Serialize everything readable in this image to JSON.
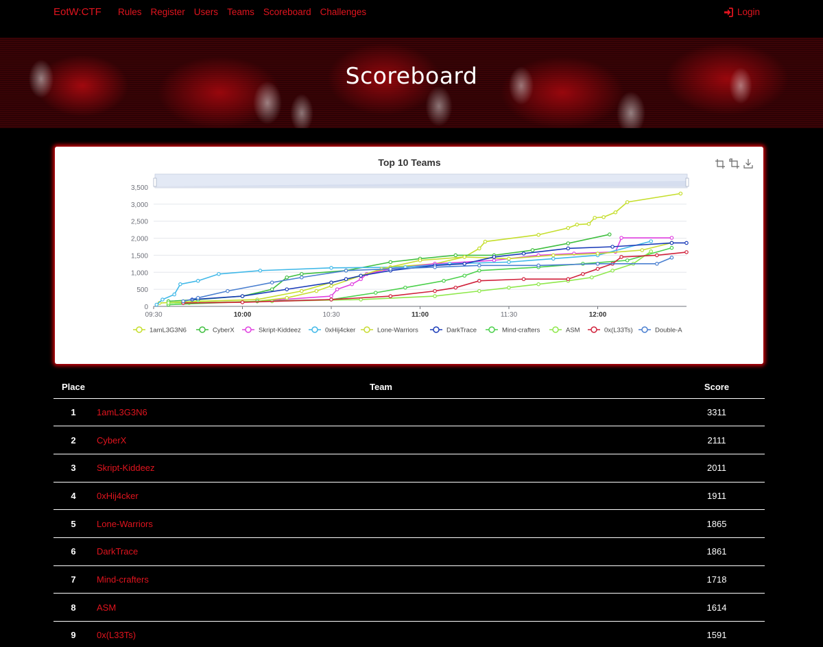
{
  "navbar": {
    "brand": "EotW:CTF",
    "links": [
      "Rules",
      "Register",
      "Users",
      "Teams",
      "Scoreboard",
      "Challenges"
    ],
    "login_label": "Login"
  },
  "hero": {
    "title": "Scoreboard"
  },
  "table": {
    "headers": {
      "place": "Place",
      "team": "Team",
      "score": "Score"
    },
    "rows": [
      {
        "place": "1",
        "team": "1amL3G3N6",
        "score": "3311"
      },
      {
        "place": "2",
        "team": "CyberX",
        "score": "2111"
      },
      {
        "place": "3",
        "team": "Skript-Kiddeez",
        "score": "2011"
      },
      {
        "place": "4",
        "team": "0xHij4cker",
        "score": "1911"
      },
      {
        "place": "5",
        "team": "Lone-Warriors",
        "score": "1865"
      },
      {
        "place": "6",
        "team": "DarkTrace",
        "score": "1861"
      },
      {
        "place": "7",
        "team": "Mind-crafters",
        "score": "1718"
      },
      {
        "place": "8",
        "team": "ASM",
        "score": "1614"
      },
      {
        "place": "9",
        "team": "0x(L33Ts)",
        "score": "1591"
      }
    ]
  },
  "colors": {
    "accent": "#e0141e",
    "background": "#000000",
    "card_glow": "#c8000a"
  },
  "icons": {
    "login": "sign-in-icon",
    "toolbox": [
      "zoom-icon",
      "zoom-reset-icon",
      "save-image-icon"
    ]
  },
  "chart_data": {
    "type": "line",
    "title": "Top 10 Teams",
    "x_ticks": [
      "09:30",
      "10:00",
      "10:30",
      "11:00",
      "11:30",
      "12:00"
    ],
    "x_bold_ticks": [
      "10:00",
      "11:00",
      "12:00"
    ],
    "xlim": [
      "09:30",
      "12:30"
    ],
    "y_ticks": [
      "0",
      "500",
      "1,000",
      "1,500",
      "2,000",
      "2,500",
      "3,000",
      "3,500"
    ],
    "ylim": [
      0,
      3500
    ],
    "grid": true,
    "legend_position": "bottom",
    "data_zoom_slider": true,
    "series": [
      {
        "name": "1amL3G3N6",
        "color": "#c5de2b",
        "points": [
          [
            "09:32",
            100
          ],
          [
            "09:45",
            150
          ],
          [
            "10:05",
            200
          ],
          [
            "10:20",
            450
          ],
          [
            "10:30",
            700
          ],
          [
            "10:40",
            900
          ],
          [
            "10:50",
            1150
          ],
          [
            "11:05",
            1250
          ],
          [
            "11:15",
            1450
          ],
          [
            "11:20",
            1700
          ],
          [
            "11:22",
            1900
          ],
          [
            "11:40",
            2100
          ],
          [
            "11:50",
            2300
          ],
          [
            "11:53",
            2400
          ],
          [
            "11:57",
            2420
          ],
          [
            "11:59",
            2600
          ],
          [
            "12:02",
            2620
          ],
          [
            "12:06",
            2760
          ],
          [
            "12:10",
            3060
          ],
          [
            "12:28",
            3311
          ]
        ]
      },
      {
        "name": "CyberX",
        "color": "#3fbf3f",
        "points": [
          [
            "09:35",
            150
          ],
          [
            "09:45",
            200
          ],
          [
            "10:00",
            300
          ],
          [
            "10:10",
            500
          ],
          [
            "10:15",
            850
          ],
          [
            "10:20",
            950
          ],
          [
            "10:35",
            1050
          ],
          [
            "10:50",
            1300
          ],
          [
            "11:00",
            1400
          ],
          [
            "11:12",
            1500
          ],
          [
            "11:25",
            1500
          ],
          [
            "11:38",
            1650
          ],
          [
            "11:50",
            1850
          ],
          [
            "12:04",
            2111
          ]
        ]
      },
      {
        "name": "Skript-Kiddeez",
        "color": "#e040e0",
        "points": [
          [
            "09:40",
            100
          ],
          [
            "10:05",
            150
          ],
          [
            "10:30",
            300
          ],
          [
            "10:32",
            500
          ],
          [
            "10:37",
            650
          ],
          [
            "10:40",
            800
          ],
          [
            "10:42",
            950
          ],
          [
            "10:50",
            1100
          ],
          [
            "11:05",
            1250
          ],
          [
            "11:25",
            1350
          ],
          [
            "11:40",
            1500
          ],
          [
            "11:52",
            1550
          ],
          [
            "12:06",
            1600
          ],
          [
            "12:08",
            2011
          ],
          [
            "12:25",
            2011
          ]
        ]
      },
      {
        "name": "0xHij4cker",
        "color": "#40b8e8",
        "points": [
          [
            "09:31",
            50
          ],
          [
            "09:33",
            200
          ],
          [
            "09:37",
            350
          ],
          [
            "09:39",
            650
          ],
          [
            "09:45",
            750
          ],
          [
            "09:52",
            950
          ],
          [
            "10:06",
            1050
          ],
          [
            "10:30",
            1130
          ],
          [
            "10:55",
            1150
          ],
          [
            "11:10",
            1250
          ],
          [
            "11:30",
            1300
          ],
          [
            "11:45",
            1400
          ],
          [
            "12:00",
            1500
          ],
          [
            "12:18",
            1911
          ]
        ]
      },
      {
        "name": "Lone-Warriors",
        "color": "#c8dc32",
        "points": [
          [
            "09:42",
            100
          ],
          [
            "10:05",
            150
          ],
          [
            "10:15",
            250
          ],
          [
            "10:25",
            450
          ],
          [
            "10:30",
            600
          ],
          [
            "10:40",
            900
          ],
          [
            "10:47",
            1100
          ],
          [
            "11:00",
            1350
          ],
          [
            "11:15",
            1450
          ],
          [
            "11:30",
            1400
          ],
          [
            "11:45",
            1500
          ],
          [
            "12:00",
            1550
          ],
          [
            "12:15",
            1650
          ],
          [
            "12:25",
            1865
          ]
        ]
      },
      {
        "name": "DarkTrace",
        "color": "#1a3bb8",
        "points": [
          [
            "09:43",
            200
          ],
          [
            "10:00",
            300
          ],
          [
            "10:15",
            500
          ],
          [
            "10:30",
            700
          ],
          [
            "10:35",
            800
          ],
          [
            "10:40",
            900
          ],
          [
            "10:50",
            1050
          ],
          [
            "11:05",
            1200
          ],
          [
            "11:15",
            1250
          ],
          [
            "11:25",
            1450
          ],
          [
            "11:35",
            1550
          ],
          [
            "11:50",
            1700
          ],
          [
            "12:05",
            1750
          ],
          [
            "12:25",
            1861
          ],
          [
            "12:30",
            1861
          ]
        ]
      },
      {
        "name": "Mind-crafters",
        "color": "#4ad04a",
        "points": [
          [
            "09:35",
            50
          ],
          [
            "10:05",
            150
          ],
          [
            "10:30",
            200
          ],
          [
            "10:45",
            400
          ],
          [
            "10:55",
            550
          ],
          [
            "11:08",
            750
          ],
          [
            "11:15",
            900
          ],
          [
            "11:20",
            1050
          ],
          [
            "11:40",
            1150
          ],
          [
            "11:55",
            1250
          ],
          [
            "12:10",
            1350
          ],
          [
            "12:25",
            1718
          ]
        ]
      },
      {
        "name": "ASM",
        "color": "#8ee84a",
        "points": [
          [
            "09:35",
            100
          ],
          [
            "10:10",
            150
          ],
          [
            "10:40",
            200
          ],
          [
            "11:05",
            300
          ],
          [
            "11:20",
            450
          ],
          [
            "11:30",
            550
          ],
          [
            "11:40",
            650
          ],
          [
            "11:50",
            750
          ],
          [
            "11:58",
            850
          ],
          [
            "12:05",
            1050
          ],
          [
            "12:12",
            1250
          ],
          [
            "12:18",
            1614
          ]
        ]
      },
      {
        "name": "0x(L33Ts)",
        "color": "#d0203a",
        "points": [
          [
            "09:40",
            100
          ],
          [
            "10:00",
            120
          ],
          [
            "10:30",
            200
          ],
          [
            "10:50",
            300
          ],
          [
            "11:05",
            450
          ],
          [
            "11:12",
            550
          ],
          [
            "11:20",
            750
          ],
          [
            "11:35",
            800
          ],
          [
            "11:50",
            800
          ],
          [
            "11:55",
            950
          ],
          [
            "12:00",
            1100
          ],
          [
            "12:05",
            1250
          ],
          [
            "12:08",
            1450
          ],
          [
            "12:20",
            1500
          ],
          [
            "12:30",
            1591
          ]
        ]
      },
      {
        "name": "Double-A",
        "color": "#4a7fd0",
        "points": [
          [
            "09:40",
            150
          ],
          [
            "09:45",
            250
          ],
          [
            "09:55",
            450
          ],
          [
            "10:10",
            700
          ],
          [
            "10:20",
            850
          ],
          [
            "10:35",
            1050
          ],
          [
            "10:50",
            1100
          ],
          [
            "11:05",
            1150
          ],
          [
            "11:20",
            1200
          ],
          [
            "11:40",
            1200
          ],
          [
            "12:00",
            1250
          ],
          [
            "12:20",
            1250
          ],
          [
            "12:25",
            1431
          ]
        ]
      }
    ]
  }
}
